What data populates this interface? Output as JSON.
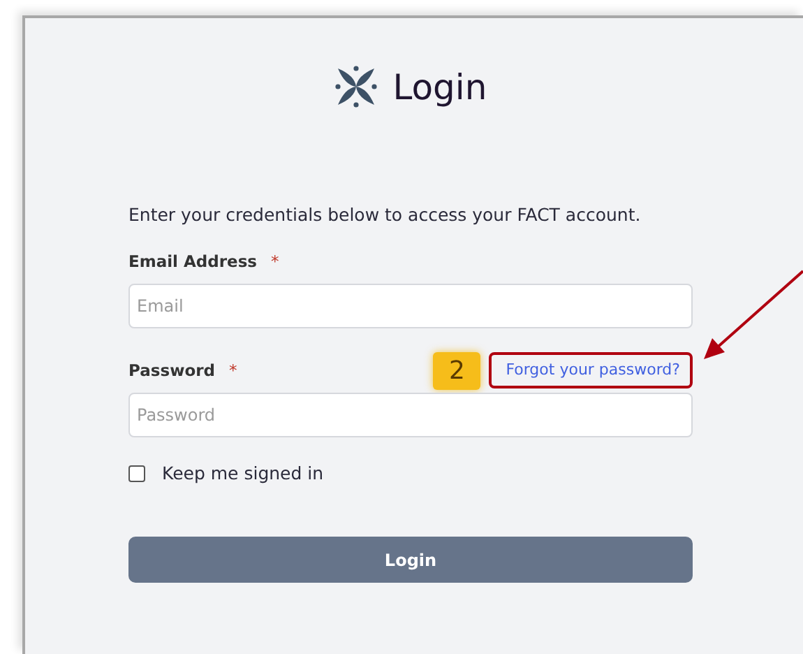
{
  "title": "Login",
  "intro": "Enter your credentials below to access your FACT account.",
  "fields": [
    {
      "label": "Email Address",
      "required_mark": "*",
      "placeholder": "Email"
    },
    {
      "label": "Password",
      "required_mark": "*",
      "placeholder": "Password",
      "link": "Forgot your password?",
      "annotation": "2"
    }
  ],
  "remember": {
    "label": "Keep me signed in",
    "checked": false
  },
  "button": "Login"
}
